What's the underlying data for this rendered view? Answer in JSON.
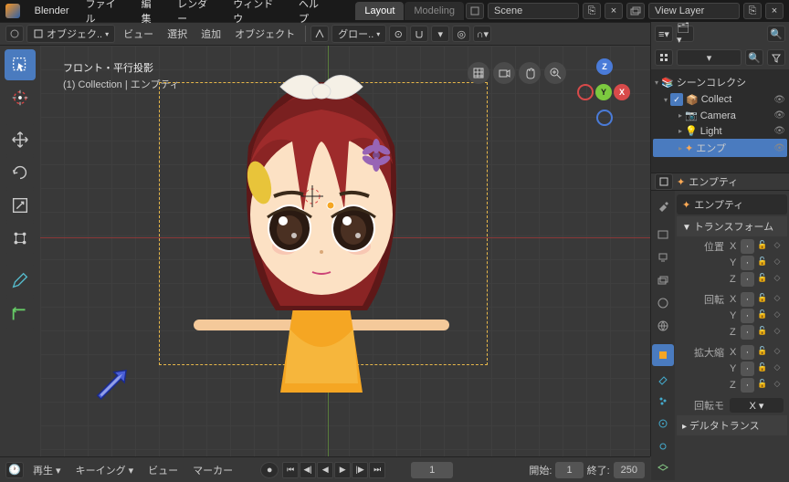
{
  "topmenu": {
    "app": "Blender",
    "file": "ファイル",
    "edit": "編集",
    "render": "レンダー",
    "window": "ウィンドウ",
    "help": "ヘルプ"
  },
  "workspace": {
    "layout": "Layout",
    "modeling": "Modeling"
  },
  "scene": {
    "scene_label": "Scene",
    "layer_label": "View Layer"
  },
  "header2": {
    "mode": "オブジェク..",
    "view": "ビュー",
    "select": "選択",
    "add": "追加",
    "object": "オブジェクト",
    "global": "グロー.."
  },
  "viewport": {
    "proj": "フロント・平行投影",
    "collection": "(1) Collection | エンプティ"
  },
  "outliner": {
    "title": "シーンコレクシ",
    "items": [
      {
        "label": "Collect",
        "icon": "box",
        "indent": 1,
        "sel": false,
        "check": true
      },
      {
        "label": "Camera",
        "icon": "cam",
        "indent": 2,
        "sel": false
      },
      {
        "label": "Light",
        "icon": "light",
        "indent": 2,
        "sel": false
      },
      {
        "label": "エンプ",
        "icon": "empty",
        "indent": 2,
        "sel": true
      }
    ]
  },
  "props": {
    "obj": "エンプティ",
    "obj2": "エンプティ",
    "transform": "トランスフォーム",
    "loc": "位置",
    "rot": "回転",
    "scale": "拡大縮",
    "rotmode": "回転モ",
    "delta": "デルタトランス",
    "x": "X",
    "y": "Y",
    "z": "Z",
    "dot": "·"
  },
  "timeline": {
    "play": "再生",
    "keying": "キーイング",
    "view": "ビュー",
    "marker": "マーカー",
    "frame": "1",
    "start_lbl": "開始:",
    "start": "1",
    "end_lbl": "終了:",
    "end": "250"
  }
}
